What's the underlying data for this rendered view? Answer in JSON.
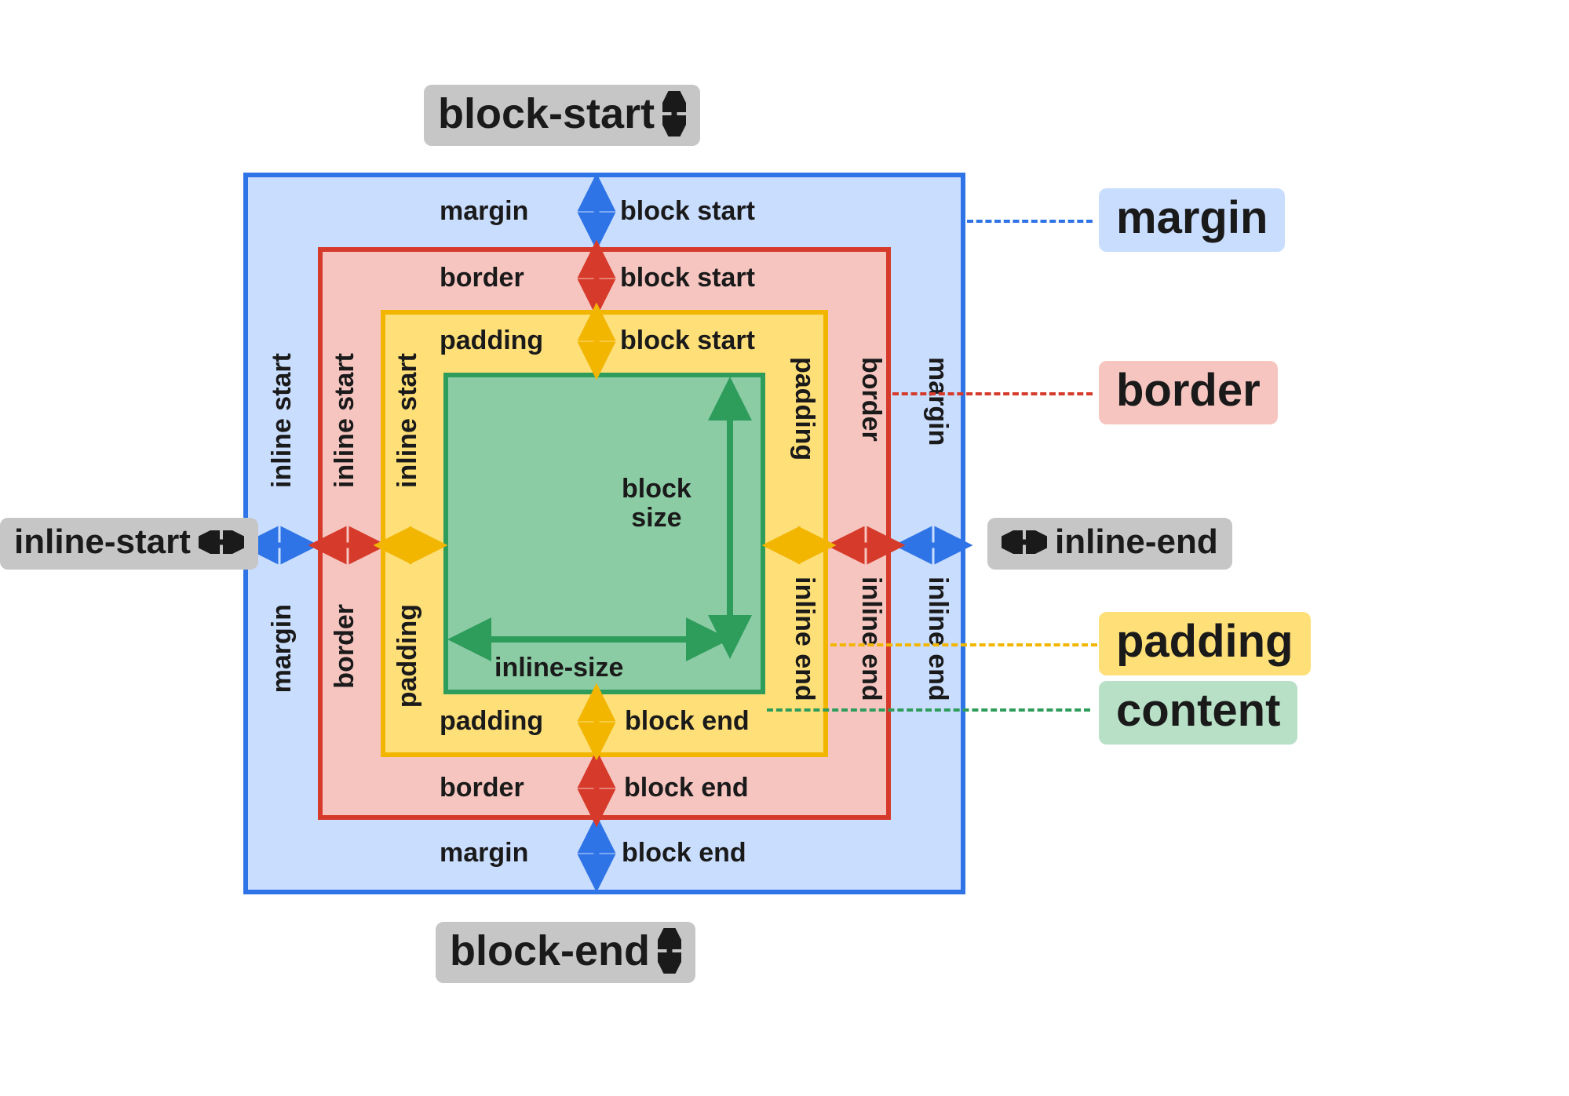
{
  "outer_badges": {
    "block_start": "block-start",
    "block_end": "block-end",
    "inline_start": "inline-start",
    "inline_end": "inline-end"
  },
  "legend": {
    "margin": "margin",
    "border": "border",
    "padding": "padding",
    "content": "content"
  },
  "margin": {
    "top_left": "margin",
    "top_right": "block start",
    "bottom_left": "margin",
    "bottom_right": "block end",
    "left_top": "margin",
    "left_bottom": "inline start",
    "right_top": "margin",
    "right_bottom": "inline end"
  },
  "border": {
    "top_left": "border",
    "top_right": "block start",
    "bottom_left": "border",
    "bottom_right": "block end",
    "left_top": "border",
    "left_bottom": "inline start",
    "right_top": "border",
    "right_bottom": "inline end"
  },
  "padding": {
    "top_left": "padding",
    "top_right": "block start",
    "bottom_left": "padding",
    "bottom_right": "block end",
    "left_top": "padding",
    "left_bottom": "inline start",
    "right_top": "padding",
    "right_bottom": "inline end"
  },
  "content": {
    "block_size": "block\nsize",
    "inline_size": "inline-size"
  },
  "colors": {
    "blue": "#2f74e6",
    "red": "#d63a2a",
    "yellow": "#f2b600",
    "green": "#2e9d5c",
    "ink": "#1a1a1a"
  }
}
